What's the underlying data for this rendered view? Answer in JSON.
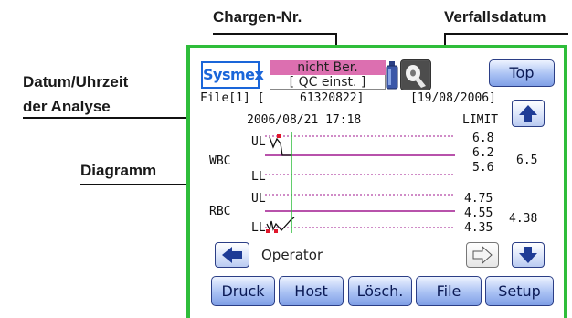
{
  "callouts": {
    "chargen": "Chargen-Nr.",
    "verfall": "Verfallsdatum",
    "datum_line1": "Datum/Uhrzeit",
    "datum_line2": "der Analyse",
    "diagramm": "Diagramm"
  },
  "device": {
    "logo": "Sysmex",
    "status_line1": "nicht Ber.",
    "status_line2": "[ QC einst. ]",
    "top_button": "Top",
    "file_label": "File[1] [",
    "lot_number": "61320822]",
    "expiry": "[19/08/2006]",
    "analysis_datetime": "2006/08/21   17:18",
    "limit_label": "LIMIT",
    "operator": "Operator"
  },
  "params": [
    {
      "name": "WBC",
      "ul_label": "UL",
      "ll_label": "LL",
      "upper": "6.8",
      "target": "6.2",
      "lower": "5.6",
      "current": "6.5"
    },
    {
      "name": "RBC",
      "ul_label": "UL",
      "ll_label": "LL",
      "upper": "4.75",
      "target": "4.55",
      "lower": "4.35",
      "current": "4.38"
    }
  ],
  "bottom_buttons": [
    "Druck",
    "Host",
    "Lösch.",
    "File",
    "Setup"
  ],
  "icons": {
    "up": "arrow-up-icon",
    "down": "arrow-down-icon",
    "left": "arrow-left-icon",
    "right": "arrow-right-icon",
    "bottle": "reagent-bottle-icon",
    "roll": "paper-roll-icon"
  },
  "colors": {
    "frame": "#2ebd3a",
    "status_bg": "#dc6fb0",
    "chart_line": "#a0198f",
    "cursor": "#2ebd3a",
    "marker": "#e0162b",
    "logo": "#1a66d9"
  }
}
